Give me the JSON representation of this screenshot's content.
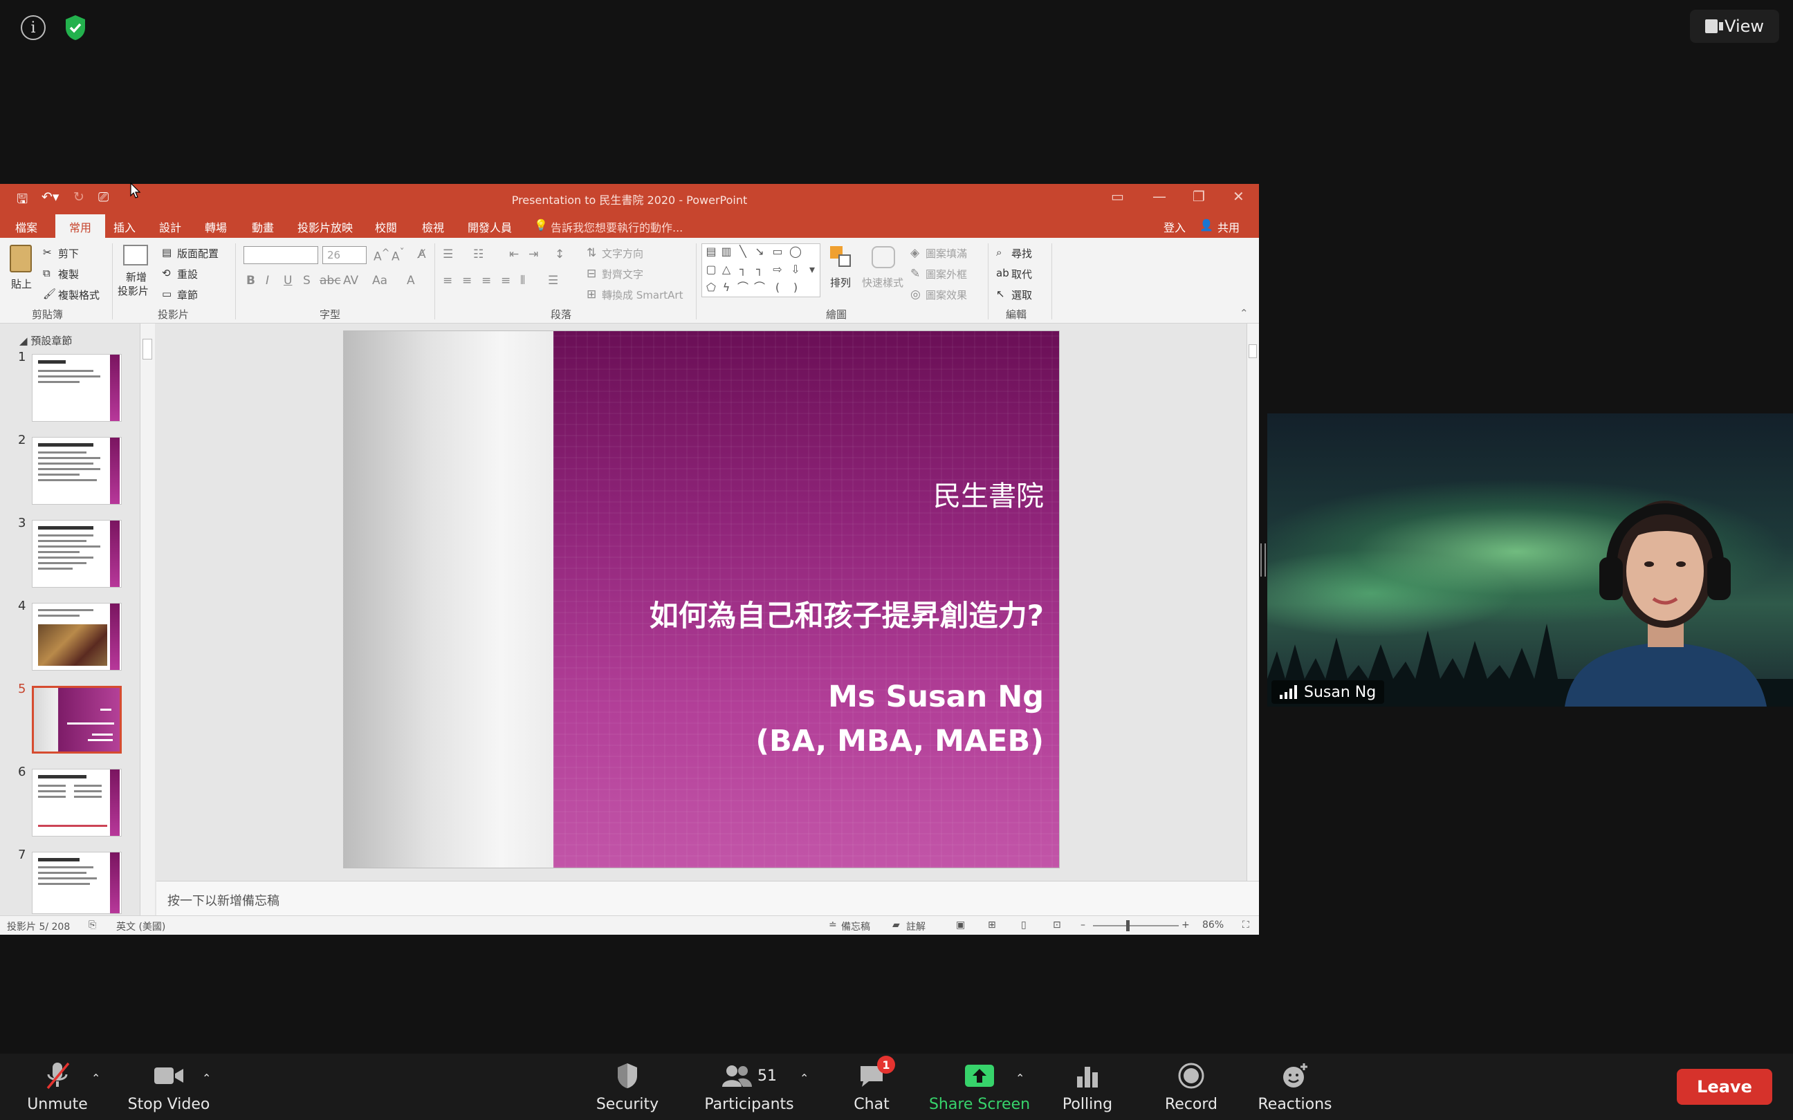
{
  "zoom": {
    "view_label": "View",
    "toolbar": {
      "unmute": "Unmute",
      "stop_video": "Stop Video",
      "security": "Security",
      "participants": "Participants",
      "participants_count": "51",
      "chat": "Chat",
      "chat_badge": "1",
      "share_screen": "Share Screen",
      "polling": "Polling",
      "record": "Record",
      "reactions": "Reactions",
      "leave": "Leave"
    },
    "video": {
      "participant_name": "Susan Ng"
    },
    "colors": {
      "share_green": "#37d36b",
      "leave_red": "#d6322b"
    }
  },
  "ppt": {
    "title": "Presentation to 民生書院 2020 - PowerPoint",
    "tabs": [
      "檔案",
      "常用",
      "插入",
      "設計",
      "轉場",
      "動畫",
      "投影片放映",
      "校閱",
      "檢視",
      "開發人員"
    ],
    "tell_me": "告訴我您想要執行的動作...",
    "signin": "登入",
    "share": "共用",
    "ribbon": {
      "paste": "貼上",
      "cut": "剪下",
      "copy": "複製",
      "format_painter": "複製格式",
      "clipboard": "剪貼簿",
      "new_slide_1": "新增",
      "new_slide_2": "投影片",
      "layout": "版面配置",
      "reset": "重設",
      "section": "章節",
      "slides_group": "投影片",
      "font_size": "26",
      "font_group": "字型",
      "text_direction": "文字方向",
      "align_text": "對齊文字",
      "smartart": "轉換成 SmartArt",
      "paragraph_group": "段落",
      "arrange": "排列",
      "quick_styles": "快速樣式",
      "shape_fill": "圖案填滿",
      "shape_outline": "圖案外框",
      "shape_effects": "圖案效果",
      "drawing_group": "繪圖",
      "find": "尋找",
      "replace": "取代",
      "select": "選取",
      "editing_group": "編輯"
    },
    "section_name": "預設章節",
    "slide_numbers": [
      "1",
      "2",
      "3",
      "4",
      "5",
      "6",
      "7"
    ],
    "slide": {
      "college": "民生書院",
      "question": "如何為自己和孩子提昇創造力?",
      "name": "Ms Susan Ng",
      "credentials": "(BA, MBA, MAEB)"
    },
    "notes_placeholder": "按一下以新增備忘稿",
    "status": {
      "slide_counter": "投影片 5/ 208",
      "language": "英文 (美國)",
      "notes": "備忘稿",
      "comments": "註解",
      "zoom": "86%"
    },
    "colors": {
      "accent": "#c7452e"
    }
  }
}
